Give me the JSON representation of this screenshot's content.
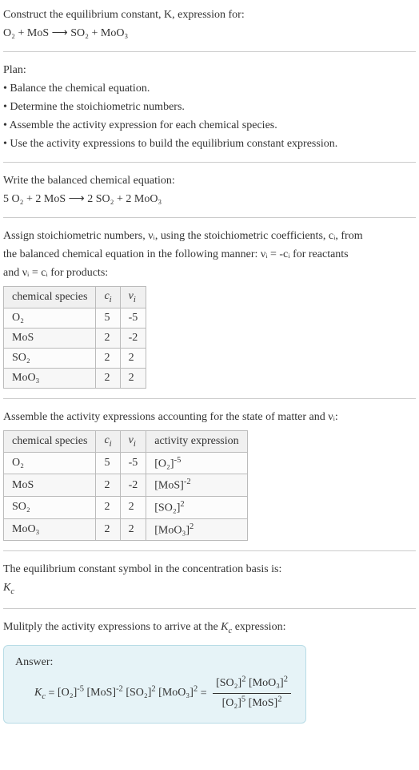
{
  "header": {
    "line1": "Construct the equilibrium constant, K, expression for:",
    "equation": "O₂ + MoS ⟶ SO₂ + MoO₃"
  },
  "plan": {
    "title": "Plan:",
    "b1": "• Balance the chemical equation.",
    "b2": "• Determine the stoichiometric numbers.",
    "b3": "• Assemble the activity expression for each chemical species.",
    "b4": "• Use the activity expressions to build the equilibrium constant expression."
  },
  "balanced": {
    "title": "Write the balanced chemical equation:",
    "equation": "5 O₂ + 2 MoS ⟶ 2 SO₂ + 2 MoO₃"
  },
  "stoich": {
    "intro1": "Assign stoichiometric numbers, νᵢ, using the stoichiometric coefficients, cᵢ, from",
    "intro2": "the balanced chemical equation in the following manner: νᵢ = -cᵢ for reactants",
    "intro3": "and νᵢ = cᵢ for products:",
    "headers": [
      "chemical species",
      "cᵢ",
      "νᵢ"
    ],
    "rows": [
      [
        "O₂",
        "5",
        "-5"
      ],
      [
        "MoS",
        "2",
        "-2"
      ],
      [
        "SO₂",
        "2",
        "2"
      ],
      [
        "MoO₃",
        "2",
        "2"
      ]
    ]
  },
  "activity": {
    "intro": "Assemble the activity expressions accounting for the state of matter and νᵢ:",
    "headers": [
      "chemical species",
      "cᵢ",
      "νᵢ",
      "activity expression"
    ],
    "rows": [
      {
        "sp": "O₂",
        "c": "5",
        "v": "-5",
        "base": "[O₂]",
        "exp": "-5"
      },
      {
        "sp": "MoS",
        "c": "2",
        "v": "-2",
        "base": "[MoS]",
        "exp": "-2"
      },
      {
        "sp": "SO₂",
        "c": "2",
        "v": "2",
        "base": "[SO₂]",
        "exp": "2"
      },
      {
        "sp": "MoO₃",
        "c": "2",
        "v": "2",
        "base": "[MoO₃]",
        "exp": "2"
      }
    ]
  },
  "eqconst": {
    "line1": "The equilibrium constant symbol in the concentration basis is:",
    "symbol": "K𝒸"
  },
  "multiply": {
    "intro": "Mulitply the activity expressions to arrive at the K𝒸 expression:",
    "answer_label": "Answer:",
    "kc_prefix": "K𝒸 = ",
    "terms": [
      {
        "base": "[O₂]",
        "exp": "-5"
      },
      {
        "base": "[MoS]",
        "exp": "-2"
      },
      {
        "base": "[SO₂]",
        "exp": "2"
      },
      {
        "base": "[MoO₃]",
        "exp": "2"
      }
    ],
    "frac_num": [
      {
        "base": "[SO₂]",
        "exp": "2"
      },
      {
        "base": "[MoO₃]",
        "exp": "2"
      }
    ],
    "frac_den": [
      {
        "base": "[O₂]",
        "exp": "5"
      },
      {
        "base": "[MoS]",
        "exp": "2"
      }
    ]
  },
  "chart_data": {
    "type": "table",
    "tables": [
      {
        "title": "Stoichiometric numbers",
        "columns": [
          "chemical species",
          "c_i",
          "ν_i"
        ],
        "rows": [
          [
            "O2",
            5,
            -5
          ],
          [
            "MoS",
            2,
            -2
          ],
          [
            "SO2",
            2,
            2
          ],
          [
            "MoO3",
            2,
            2
          ]
        ]
      },
      {
        "title": "Activity expressions",
        "columns": [
          "chemical species",
          "c_i",
          "ν_i",
          "activity expression"
        ],
        "rows": [
          [
            "O2",
            5,
            -5,
            "[O2]^-5"
          ],
          [
            "MoS",
            2,
            -2,
            "[MoS]^-2"
          ],
          [
            "SO2",
            2,
            2,
            "[SO2]^2"
          ],
          [
            "MoO3",
            2,
            2,
            "[MoO3]^2"
          ]
        ]
      }
    ]
  }
}
